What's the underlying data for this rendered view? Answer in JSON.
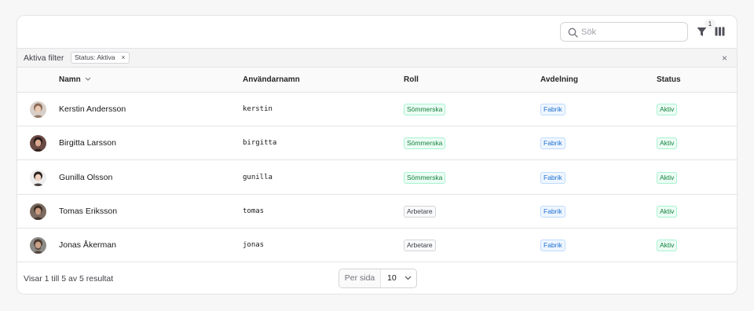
{
  "toolbar": {
    "search_placeholder": "Sök",
    "filter_count": "1"
  },
  "active_filters": {
    "label": "Aktiva filter",
    "chips": [
      "Status: Aktiva"
    ],
    "chip_remove": "×",
    "clear_all": "×"
  },
  "table": {
    "columns": {
      "name": "Namn",
      "username": "Användarnamn",
      "role": "Roll",
      "department": "Avdelning",
      "status": "Status"
    },
    "sort_column": "name",
    "rows": [
      {
        "name": "Kerstin Andersson",
        "username": "kerstin",
        "role": "Sömmerska",
        "role_color": "green",
        "department": "Fabrik",
        "status": "Aktiv",
        "avatar": "woman-light-hair"
      },
      {
        "name": "Birgitta Larsson",
        "username": "birgitta",
        "role": "Sömmerska",
        "role_color": "green",
        "department": "Fabrik",
        "status": "Aktiv",
        "avatar": "woman-dark-hair"
      },
      {
        "name": "Gunilla Olsson",
        "username": "gunilla",
        "role": "Sömmerska",
        "role_color": "green",
        "department": "Fabrik",
        "status": "Aktiv",
        "avatar": "woman-dark-hair-light-bg"
      },
      {
        "name": "Tomas Eriksson",
        "username": "tomas",
        "role": "Arbetare",
        "role_color": "gray",
        "department": "Fabrik",
        "status": "Aktiv",
        "avatar": "man-short-hair"
      },
      {
        "name": "Jonas Åkerman",
        "username": "jonas",
        "role": "Arbetare",
        "role_color": "gray",
        "department": "Fabrik",
        "status": "Aktiv",
        "avatar": "man-beard"
      }
    ]
  },
  "footer": {
    "results_text": "Visar 1 till 5 av 5 resultat",
    "per_page_label": "Per sida",
    "per_page_value": "10"
  },
  "colors": {
    "green_badge": "#15803d",
    "blue_badge": "#1d6fd1",
    "border": "#e4e4e7"
  }
}
